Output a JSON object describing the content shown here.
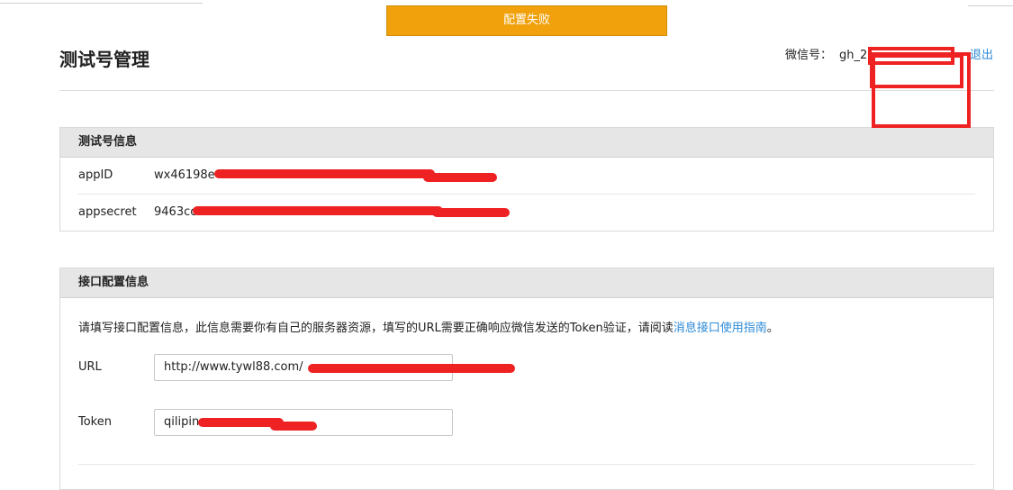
{
  "alert": {
    "text": "配置失败"
  },
  "header": {
    "title": "测试号管理",
    "account_label": "微信号：",
    "account_id": "gh_2",
    "logout_label": "退出"
  },
  "test_account_panel": {
    "title": "测试号信息",
    "rows": [
      {
        "label": "appID",
        "value": "wx46198e"
      },
      {
        "label": "appsecret",
        "value": "9463cc"
      }
    ]
  },
  "interface_panel": {
    "title": "接口配置信息",
    "description": "请填写接口配置信息，此信息需要你有自己的服务器资源，填写的URL需要正确响应微信发送的Token验证，请阅读",
    "guide_link": "消息接口使用指南",
    "description_end": "。",
    "url": {
      "label": "URL",
      "value": "http://www.tywl88.com/"
    },
    "token": {
      "label": "Token",
      "value": "qilipin"
    }
  },
  "colors": {
    "alert_bg": "#f0a10c",
    "link": "#2d8bd8",
    "redaction": "#ee2222",
    "panel_header_bg": "#e6e6e6"
  }
}
